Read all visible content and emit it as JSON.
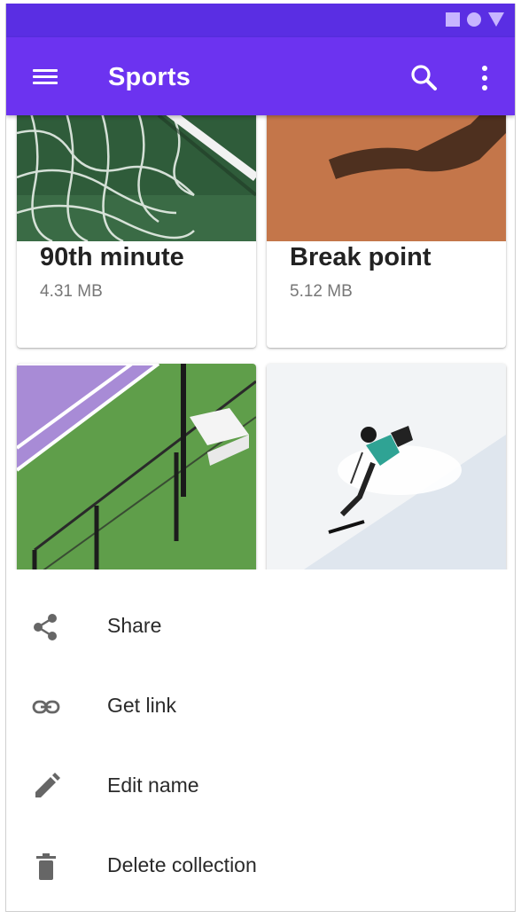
{
  "app_bar": {
    "title": "Sports",
    "color": "#6c33f0",
    "status_color": "#5a2ee3"
  },
  "status_bar": {
    "icons": [
      "square-icon",
      "circle-icon",
      "triangle-icon"
    ]
  },
  "collection_cards": [
    {
      "title": "90th minute",
      "size": "4.31 MB",
      "image": "soccer-goal-net-photo"
    },
    {
      "title": "Break point",
      "size": "5.12 MB",
      "image": "clay-court-shadow-photo"
    },
    {
      "title": "",
      "size": "",
      "image": "tennis-court-net-photo"
    },
    {
      "title": "",
      "size": "",
      "image": "skier-snow-photo"
    }
  ],
  "bottom_sheet": {
    "items": [
      {
        "label": "Share",
        "icon": "share-icon"
      },
      {
        "label": "Get link",
        "icon": "link-icon"
      },
      {
        "label": "Edit name",
        "icon": "pencil-icon"
      },
      {
        "label": "Delete collection",
        "icon": "trash-icon"
      }
    ]
  }
}
